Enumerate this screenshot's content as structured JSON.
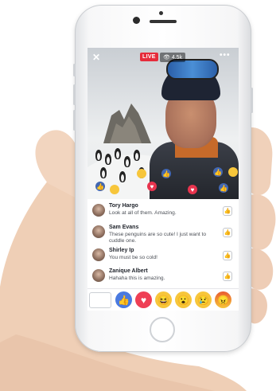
{
  "video": {
    "live_label": "LIVE",
    "viewer_count": "4.5k",
    "close_glyph": "✕",
    "more_glyph": "•••"
  },
  "comments": [
    {
      "name": "Tory Hargo",
      "text": "Look at all of them. Amazing."
    },
    {
      "name": "Sam Evans",
      "text": "These penguins are so cute! I just want to cuddle one."
    },
    {
      "name": "Shirley Ip",
      "text": "You must be so cold!"
    },
    {
      "name": "Zanique Albert",
      "text": "Hahaha this is amazing."
    }
  ],
  "reactions": [
    {
      "name": "like-reaction",
      "glyph": "👍"
    },
    {
      "name": "love-reaction",
      "glyph": "♥"
    },
    {
      "name": "haha-reaction",
      "glyph": "😆"
    },
    {
      "name": "wow-reaction",
      "glyph": "😮"
    },
    {
      "name": "sad-reaction",
      "glyph": "😢"
    },
    {
      "name": "angry-reaction",
      "glyph": "😠"
    }
  ],
  "icons": {
    "comment_like": "👍",
    "float_like": "👍",
    "float_love": "♥",
    "eye": "👁"
  },
  "colors": {
    "live_red": "#e62c3b",
    "facebook_blue": "#4267b2",
    "love_red": "#e8344e",
    "haha_yellow": "#f7c63b"
  }
}
